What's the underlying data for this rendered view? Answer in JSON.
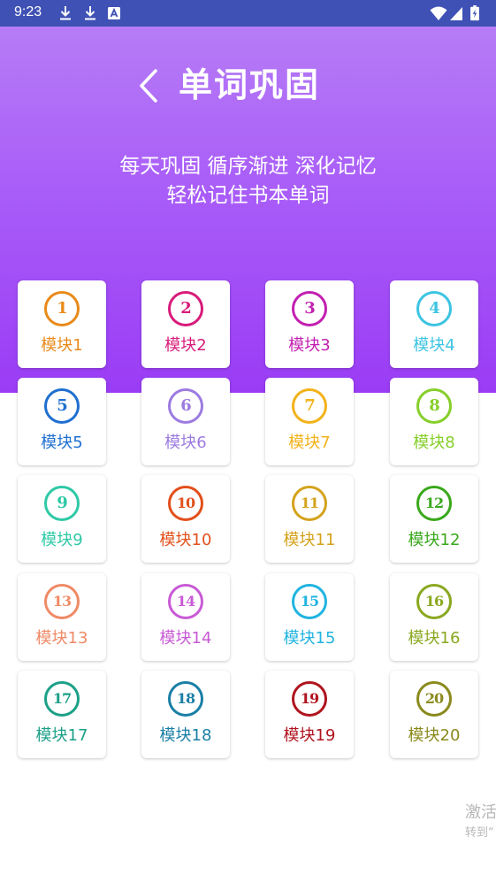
{
  "status_bar": {
    "time": "9:23",
    "left_icons": [
      "download-icon",
      "download-icon",
      "app-notification-icon"
    ],
    "right_icons": [
      "wifi-icon",
      "cellular-signal-icon",
      "battery-charging-icon"
    ],
    "background_color": "#3F51B5"
  },
  "header": {
    "back_icon": "chevron-left-icon",
    "title": "单词巩固",
    "tagline_line1": "每天巩固  循序渐进  深化记忆",
    "tagline_line2": "轻松记住书本单词",
    "gradient_colors": [
      "#b67cf6",
      "#9a3cf5"
    ]
  },
  "modules": [
    {
      "number": "1",
      "label": "模块1",
      "color": "#e88a1a"
    },
    {
      "number": "2",
      "label": "模块2",
      "color": "#d81b7a"
    },
    {
      "number": "3",
      "label": "模块3",
      "color": "#c21fb0"
    },
    {
      "number": "4",
      "label": "模块4",
      "color": "#3cc4e2"
    },
    {
      "number": "5",
      "label": "模块5",
      "color": "#1f6fd0"
    },
    {
      "number": "6",
      "label": "模块6",
      "color": "#9c7be0"
    },
    {
      "number": "7",
      "label": "模块7",
      "color": "#f2b21a"
    },
    {
      "number": "8",
      "label": "模块8",
      "color": "#86cf2a"
    },
    {
      "number": "9",
      "label": "模块9",
      "color": "#2ec9a6"
    },
    {
      "number": "10",
      "label": "模块10",
      "color": "#e2501c"
    },
    {
      "number": "11",
      "label": "模块11",
      "color": "#d4a21c"
    },
    {
      "number": "12",
      "label": "模块12",
      "color": "#3aa81c"
    },
    {
      "number": "13",
      "label": "模块13",
      "color": "#ef8a66"
    },
    {
      "number": "14",
      "label": "模块14",
      "color": "#c85ad6"
    },
    {
      "number": "15",
      "label": "模块15",
      "color": "#20b4e0"
    },
    {
      "number": "16",
      "label": "模块16",
      "color": "#8aa820"
    },
    {
      "number": "17",
      "label": "模块17",
      "color": "#1ca088"
    },
    {
      "number": "18",
      "label": "模块18",
      "color": "#1a7fa6"
    },
    {
      "number": "19",
      "label": "模块19",
      "color": "#b0141e"
    },
    {
      "number": "20",
      "label": "模块20",
      "color": "#8a8a1e"
    }
  ],
  "watermark": {
    "line1": "激活",
    "line2": "转到“"
  }
}
